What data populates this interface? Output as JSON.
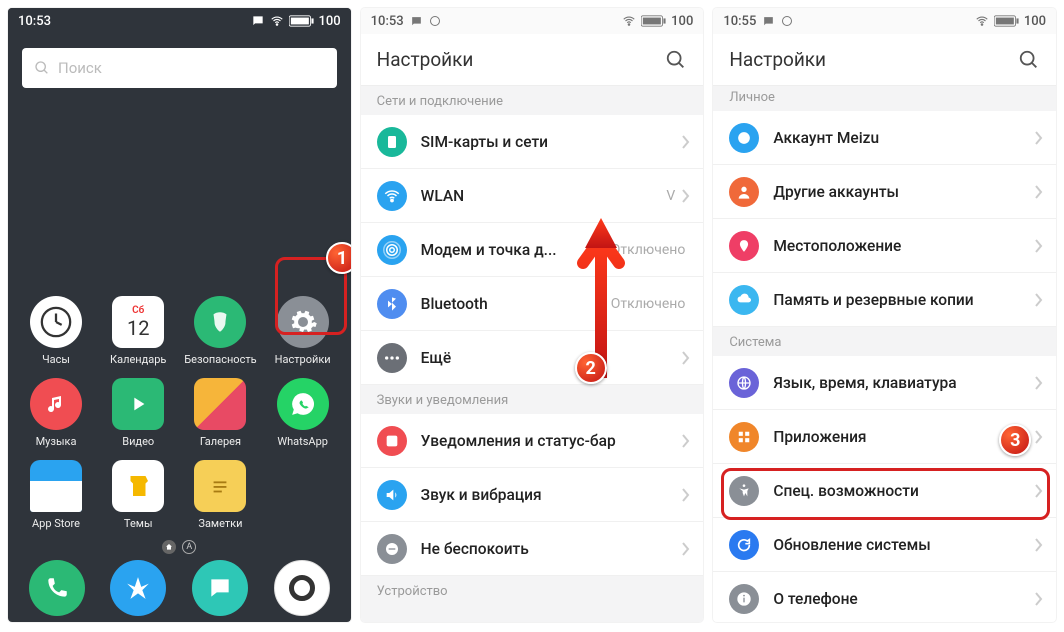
{
  "screen1": {
    "status": {
      "time": "10:53",
      "battery": "100"
    },
    "search_placeholder": "Поиск",
    "apps": {
      "row1": [
        {
          "label": "Часы",
          "bg": "#ffffff"
        },
        {
          "label": "Календарь",
          "bg": "#ffffff",
          "day": "12",
          "dow": "Сб"
        },
        {
          "label": "Безопасность",
          "bg": "#2bb975"
        },
        {
          "label": "Настройки",
          "bg": "#8a8f96"
        }
      ],
      "row2": [
        {
          "label": "Музыка",
          "bg": "#f04d52"
        },
        {
          "label": "Видео",
          "bg": "#2bb975"
        },
        {
          "label": "Галерея",
          "bg": "#f0b800"
        },
        {
          "label": "WhatsApp",
          "bg": "#25d366"
        }
      ],
      "row3": [
        {
          "label": "App Store",
          "bg": "#2aa3f0"
        },
        {
          "label": "Темы",
          "bg": "#ffffff"
        },
        {
          "label": "Заметки",
          "bg": "#f6cf57"
        },
        {
          "label": "",
          "bg": "transparent"
        }
      ],
      "dock": [
        {
          "bg": "#2bb975",
          "name": "phone"
        },
        {
          "bg": "#2aa3f0",
          "name": "browser"
        },
        {
          "bg": "#2ec7b6",
          "name": "messages"
        },
        {
          "bg": "#ffffff",
          "name": "camera"
        }
      ]
    }
  },
  "screen2": {
    "status": {
      "time": "10:53",
      "battery": "100"
    },
    "title": "Настройки",
    "section1_label": "Сети и подключение",
    "rows1": [
      {
        "icon": "#19b89a",
        "label": "SIM-карты и сети",
        "value": "",
        "name": "sim"
      },
      {
        "icon": "#2aa3f0",
        "label": "WLAN",
        "value": "V",
        "name": "wlan"
      },
      {
        "icon": "#2aa3f0",
        "label": "Модем и точка д...",
        "value": "Отключено",
        "name": "tether"
      },
      {
        "icon": "#4f8df0",
        "label": "Bluetooth",
        "value": "Отключено",
        "name": "bt"
      },
      {
        "icon": "#6b6f76",
        "label": "Ещё",
        "value": "",
        "name": "more"
      }
    ],
    "section2_label": "Звуки и уведомления",
    "rows2": [
      {
        "icon": "#f04d52",
        "label": "Уведомления и статус-бар",
        "name": "notif"
      },
      {
        "icon": "#2aa3f0",
        "label": "Звук и вибрация",
        "name": "sound"
      },
      {
        "icon": "#8a8f96",
        "label": "Не беспокоить",
        "name": "dnd"
      }
    ],
    "section3_label": "Устройство"
  },
  "screen3": {
    "status": {
      "time": "10:55",
      "battery": "100"
    },
    "title": "Настройки",
    "sectionA_label": "Личное",
    "rowsA": [
      {
        "icon": "#2aa3f0",
        "label": "Аккаунт Meizu",
        "name": "meizu-acct"
      },
      {
        "icon": "#f0693a",
        "label": "Другие аккаунты",
        "name": "other-acct"
      },
      {
        "icon": "#ef3e66",
        "label": "Местоположение",
        "name": "location"
      },
      {
        "icon": "#3bb7f0",
        "label": "Память и резервные копии",
        "name": "storage"
      }
    ],
    "sectionB_label": "Система",
    "rowsB": [
      {
        "icon": "#6a63d8",
        "label": "Язык, время, клавиатура",
        "name": "lang"
      },
      {
        "icon": "#f0862a",
        "label": "Приложения",
        "name": "apps"
      },
      {
        "icon": "#8a8f96",
        "label": "Спец. возможности",
        "name": "a11y"
      },
      {
        "icon": "#2a7af0",
        "label": "Обновление системы",
        "name": "update"
      },
      {
        "icon": "#8a8f96",
        "label": "О телефоне",
        "name": "about"
      }
    ]
  },
  "step_labels": {
    "s1": "1",
    "s2": "2",
    "s3": "3"
  }
}
